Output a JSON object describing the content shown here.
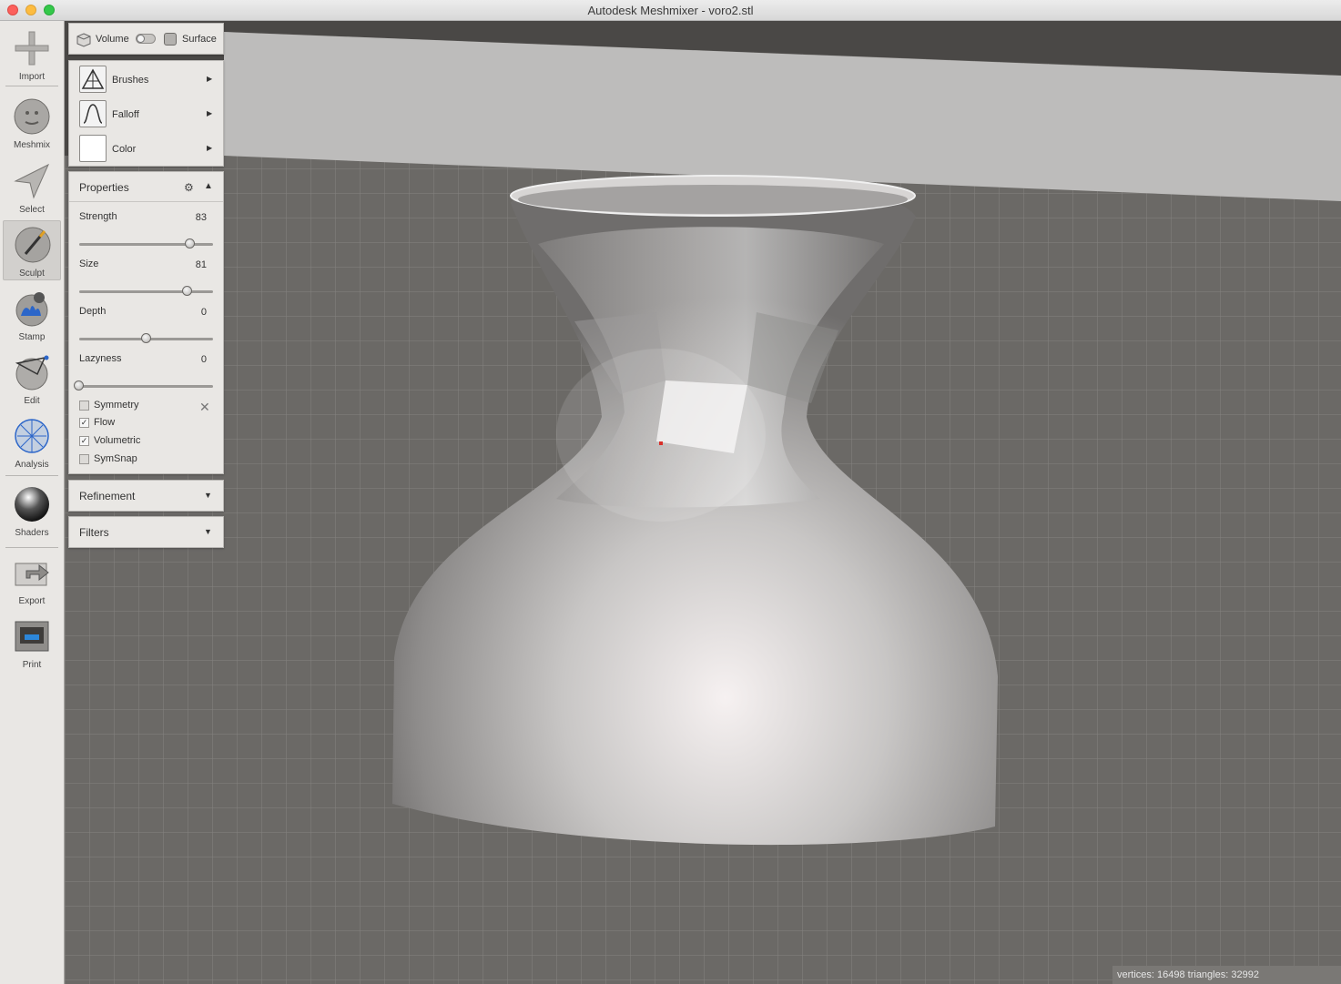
{
  "window": {
    "title": "Autodesk Meshmixer - voro2.stl"
  },
  "toolbar": {
    "items": [
      {
        "label": "Import",
        "icon": "plus-icon"
      },
      {
        "label": "Meshmix",
        "icon": "meshmix-face-icon"
      },
      {
        "label": "Select",
        "icon": "select-arrow-icon"
      },
      {
        "label": "Sculpt",
        "icon": "sculpt-brush-icon",
        "active": true
      },
      {
        "label": "Stamp",
        "icon": "stamp-icon"
      },
      {
        "label": "Edit",
        "icon": "edit-sphere-icon"
      },
      {
        "label": "Analysis",
        "icon": "analysis-sphere-icon"
      },
      {
        "label": "Shaders",
        "icon": "shader-sphere-icon"
      },
      {
        "label": "Export",
        "icon": "export-icon"
      },
      {
        "label": "Print",
        "icon": "printer-icon"
      }
    ]
  },
  "mode": {
    "volume_label": "Volume",
    "surface_label": "Surface"
  },
  "brush": {
    "brushes_label": "Brushes",
    "falloff_label": "Falloff",
    "color_label": "Color",
    "color_value": "#ffffff"
  },
  "properties": {
    "title": "Properties",
    "strength": {
      "label": "Strength",
      "value": "83",
      "fraction": 0.83
    },
    "size": {
      "label": "Size",
      "value": "81",
      "fraction": 0.81
    },
    "depth": {
      "label": "Depth",
      "value": "0",
      "fraction": 0.5
    },
    "lazyness": {
      "label": "Lazyness",
      "value": "0",
      "fraction": 0.0
    },
    "checkboxes": [
      {
        "label": "Symmetry",
        "checked": false
      },
      {
        "label": "Flow",
        "checked": true
      },
      {
        "label": "Volumetric",
        "checked": true
      },
      {
        "label": "SymSnap",
        "checked": false
      }
    ]
  },
  "refinement": {
    "title": "Refinement"
  },
  "filters": {
    "title": "Filters"
  },
  "status": {
    "text": "vertices: 16498 triangles: 32992"
  }
}
